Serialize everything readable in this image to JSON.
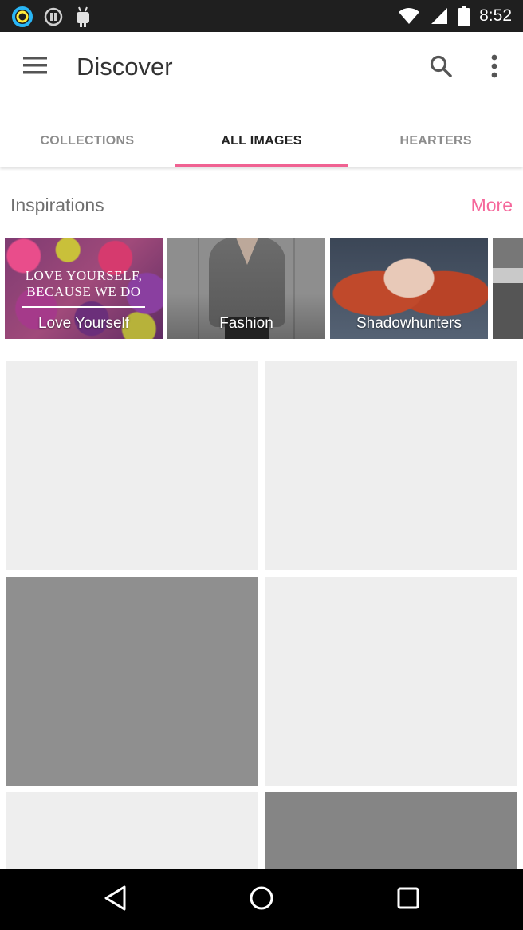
{
  "status_bar": {
    "time": "8:52",
    "left_icons": [
      "circle-ring-icon",
      "pause-circle-icon",
      "android-icon"
    ],
    "right_icons": [
      "wifi-icon",
      "signal-icon",
      "battery-icon"
    ]
  },
  "app_bar": {
    "title": "Discover",
    "icons": [
      "menu-icon",
      "search-icon",
      "more-vert-icon"
    ]
  },
  "tabs": [
    {
      "label": "COLLECTIONS",
      "active": false
    },
    {
      "label": "ALL IMAGES",
      "active": true
    },
    {
      "label": "HEARTERS",
      "active": false
    }
  ],
  "inspirations": {
    "title": "Inspirations",
    "more_label": "More",
    "cards": [
      {
        "label": "Love Yourself",
        "quote_line1": "LOVE YOURSELF,",
        "quote_line2": "BECAUSE WE DO"
      },
      {
        "label": "Fashion"
      },
      {
        "label": "Shadowhunters"
      }
    ]
  },
  "grid": {
    "tiles": [
      "light",
      "light",
      "gray",
      "light",
      "light",
      "gray"
    ]
  },
  "nav_bar": {
    "buttons": [
      "back-icon",
      "home-icon",
      "recents-icon"
    ]
  },
  "colors": {
    "accent": "#f06292",
    "more_link": "#f5679b",
    "status_bar": "#1f1f1f",
    "placeholder_light": "#eeeeee",
    "placeholder_gray": "#8f8f8f"
  }
}
